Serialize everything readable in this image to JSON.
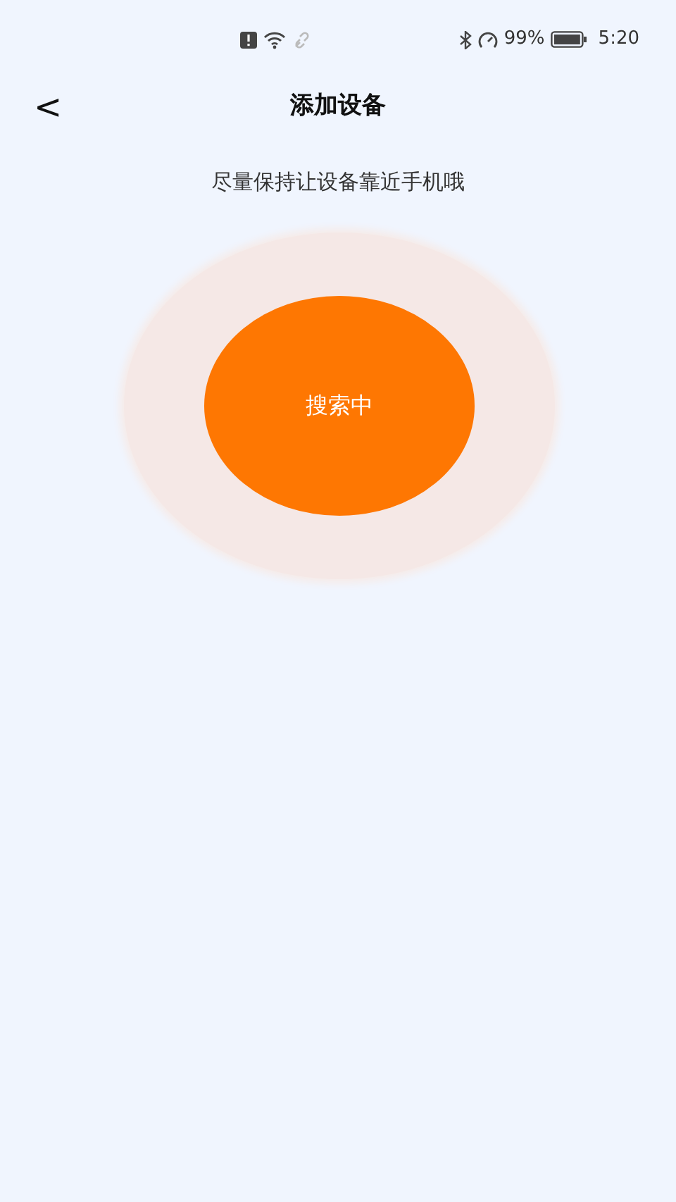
{
  "status_bar": {
    "battery_percent": "99%",
    "time": "5:20"
  },
  "header": {
    "back": "<",
    "title": "添加设备"
  },
  "hint": "尽量保持让设备靠近手机哦",
  "scan_button": {
    "label": "搜索中"
  }
}
